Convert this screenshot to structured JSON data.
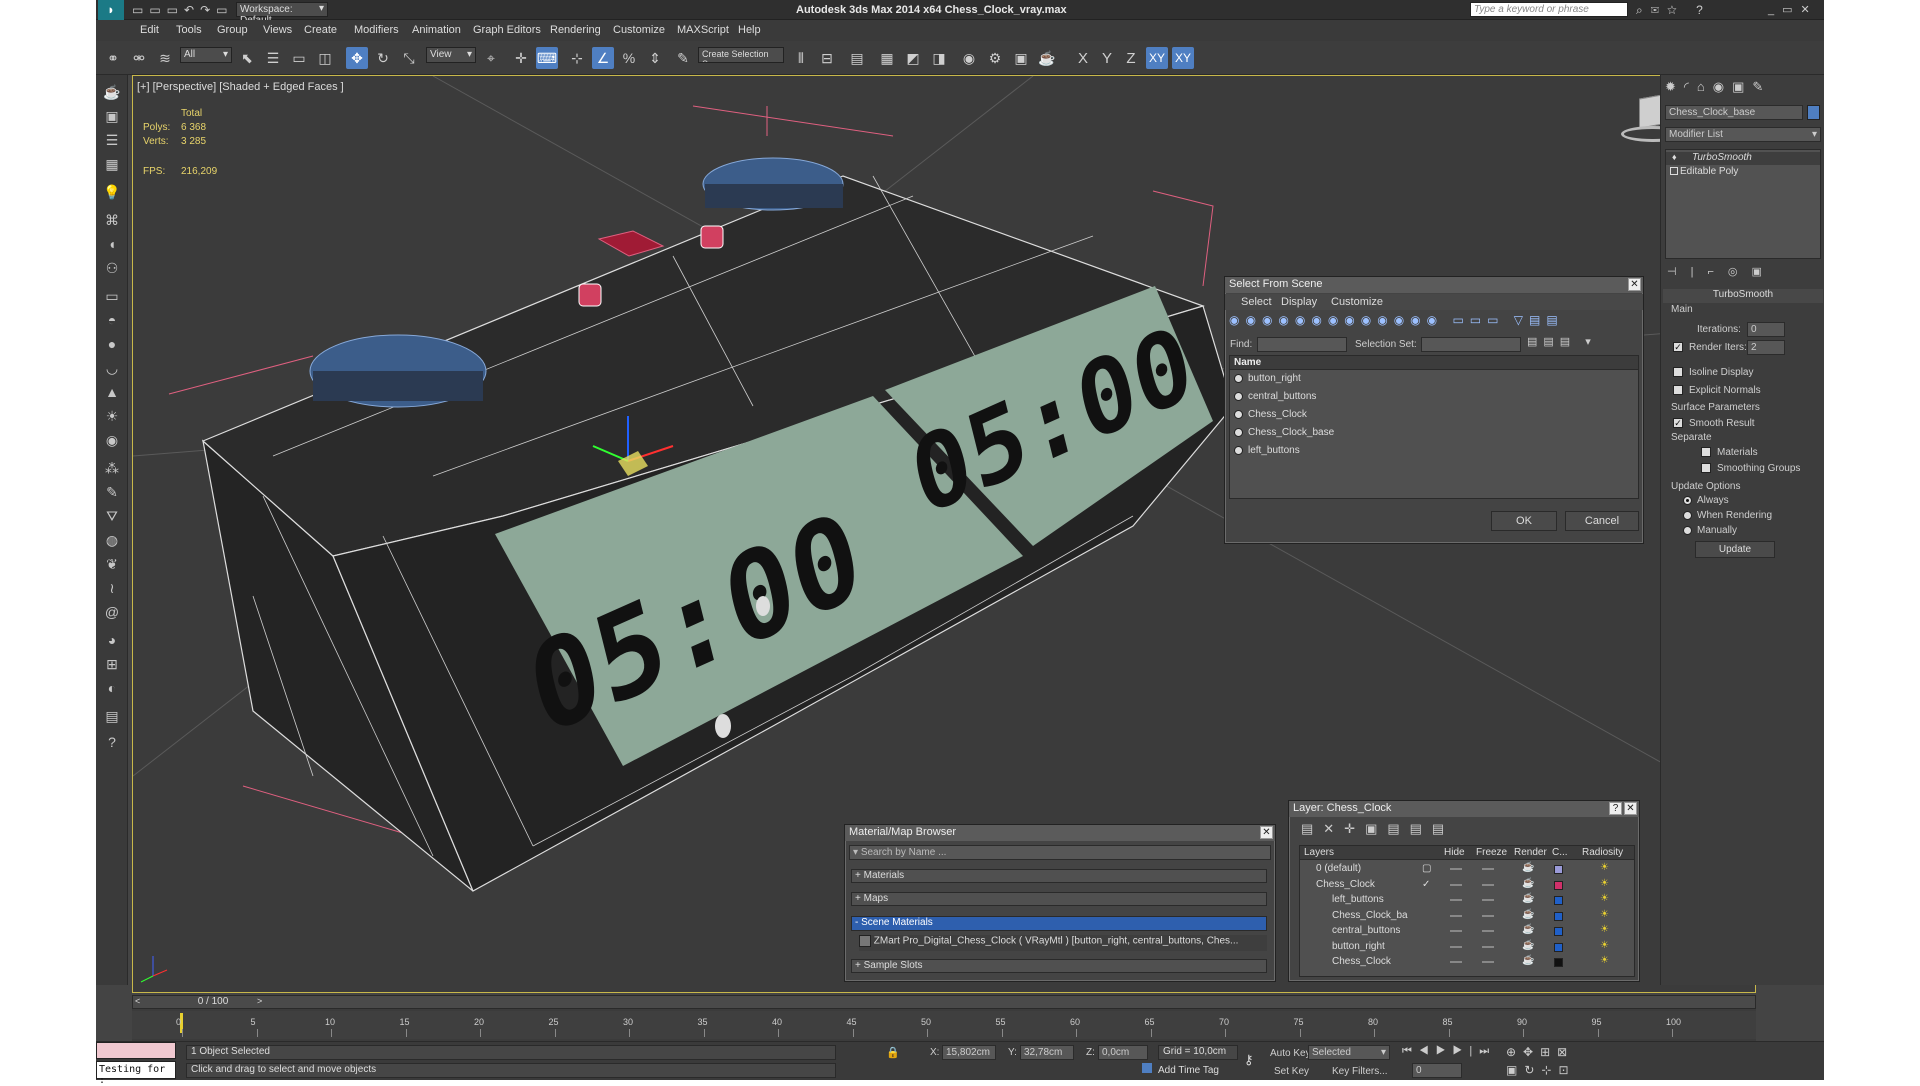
{
  "window": {
    "title": "Autodesk 3ds Max  2014 x64      Chess_Clock_vray.max",
    "workspace": "Workspace: Default",
    "search_placeholder": "Type a keyword or phrase"
  },
  "menu": [
    "Edit",
    "Tools",
    "Group",
    "Views",
    "Create",
    "Modifiers",
    "Animation",
    "Graph Editors",
    "Rendering",
    "Customize",
    "MAXScript",
    "Help"
  ],
  "toolbar": {
    "filter": "All",
    "ref_coord": "View",
    "selection_set": "Create Selection Se",
    "axes": [
      "X",
      "Y",
      "Z",
      "XY"
    ],
    "axis_extra": "XY"
  },
  "viewport": {
    "label": "[+] [Perspective] [Shaded + Edged Faces ]",
    "stats": {
      "header": "Total",
      "polys_label": "Polys:",
      "polys": "6 368",
      "verts_label": "Verts:",
      "verts": "3 285",
      "fps_label": "FPS:",
      "fps": "216,209"
    },
    "display_left": "05:00",
    "display_right": "05:00"
  },
  "select_from_scene": {
    "title": "Select From Scene",
    "menus": [
      "Select",
      "Display",
      "Customize"
    ],
    "find_label": "Find:",
    "selset_label": "Selection Set:",
    "col_name": "Name",
    "items": [
      "button_right",
      "central_buttons",
      "Chess_Clock",
      "Chess_Clock_base",
      "left_buttons"
    ],
    "ok": "OK",
    "cancel": "Cancel"
  },
  "material_browser": {
    "title": "Material/Map Browser",
    "search_placeholder": "Search by Name ...",
    "sections": [
      "+ Materials",
      "+ Maps",
      "- Scene Materials",
      "+ Sample Slots"
    ],
    "scene_material": "ZMart Pro_Digital_Chess_Clock  ( VRayMtl ) [button_right, central_buttons, Ches..."
  },
  "layer_dialog": {
    "title": "Layer: Chess_Clock",
    "help": "?",
    "columns": [
      "Layers",
      "Hide",
      "Freeze",
      "Render",
      "C...",
      "Radiosity"
    ],
    "rows": [
      {
        "name": "0 (default)",
        "color": "#9a9ad8",
        "check": "box"
      },
      {
        "name": "Chess_Clock",
        "color": "#d0306a",
        "check": "tick"
      },
      {
        "name": "left_buttons",
        "color": "#2060c8",
        "check": ""
      },
      {
        "name": "Chess_Clock_ba",
        "color": "#2060c8",
        "check": ""
      },
      {
        "name": "central_buttons",
        "color": "#2060c8",
        "check": ""
      },
      {
        "name": "button_right",
        "color": "#2060c8",
        "check": ""
      },
      {
        "name": "Chess_Clock",
        "color": "#111111",
        "check": ""
      }
    ]
  },
  "command_panel": {
    "object_name": "Chess_Clock_base",
    "modifier_list": "Modifier List",
    "stack": [
      "TurboSmooth",
      "Editable Poly"
    ],
    "rollout_title": "TurboSmooth",
    "main": "Main",
    "iterations_label": "Iterations:",
    "iterations": "0",
    "render_iters_label": "Render Iters:",
    "render_iters": "2",
    "isoline": "Isoline Display",
    "explicit": "Explicit Normals",
    "surface": "Surface Parameters",
    "smooth_result": "Smooth Result",
    "separate": "Separate",
    "materials": "Materials",
    "smoothing_groups": "Smoothing Groups",
    "update_options": "Update Options",
    "always": "Always",
    "when_rendering": "When Rendering",
    "manually": "Manually",
    "update": "Update",
    "accent": "#4f7fc2"
  },
  "timeline": {
    "frame": "0 / 100",
    "ticks": [
      "0",
      "5",
      "10",
      "15",
      "20",
      "25",
      "30",
      "35",
      "40",
      "45",
      "50",
      "55",
      "60",
      "65",
      "70",
      "75",
      "80",
      "85",
      "90",
      "95",
      "100"
    ]
  },
  "status": {
    "script_field": "Testing for :",
    "selected": "1 Object Selected",
    "prompt": "Click and drag to select and move objects",
    "x_label": "X:",
    "x": "15,802cm",
    "y_label": "Y:",
    "y": "32,78cm",
    "z_label": "Z:",
    "z": "0,0cm",
    "grid": "Grid = 10,0cm",
    "add_time_tag": "Add Time Tag",
    "auto_key": "Auto Key",
    "set_key": "Set Key",
    "key_mode": "Selected",
    "key_filters": "Key Filters...",
    "frame": "0"
  }
}
